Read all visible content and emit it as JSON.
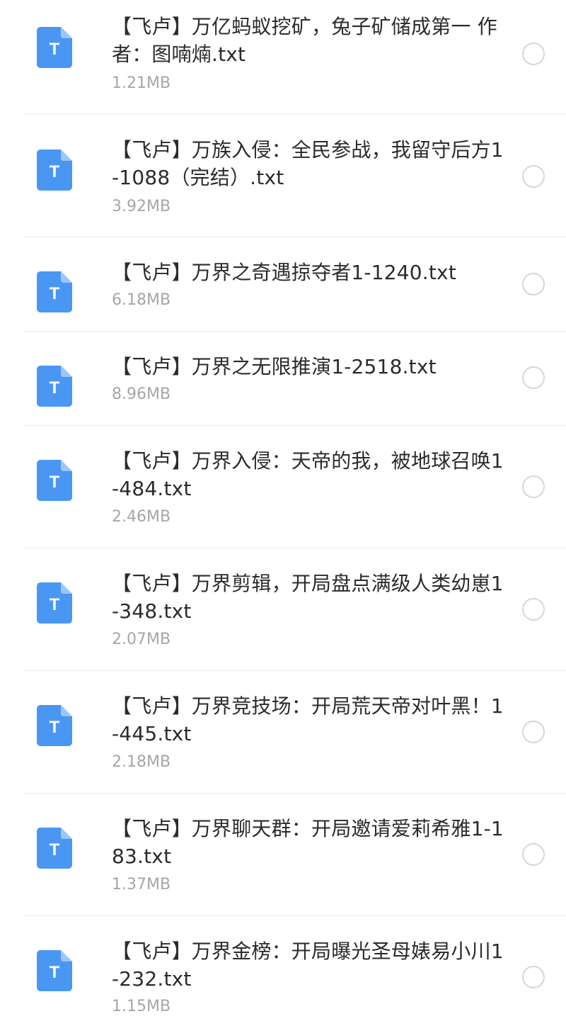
{
  "file_icon": {
    "name": "text-file-icon",
    "glyph": "T",
    "color": "#4a97f3"
  },
  "files": [
    {
      "name": "【飞卢】万亿蚂蚁挖矿，兔子矿储成第一 作者：图喃煵.txt",
      "size": "1.21MB"
    },
    {
      "name": "【飞卢】万族入侵：全民参战，我留守后方1-1088（完结）.txt",
      "size": "3.92MB"
    },
    {
      "name": "【飞卢】万界之奇遇掠夺者1-1240.txt",
      "size": "6.18MB"
    },
    {
      "name": "【飞卢】万界之无限推演1-2518.txt",
      "size": "8.96MB"
    },
    {
      "name": "【飞卢】万界入侵：天帝的我，被地球召唤1-484.txt",
      "size": "2.46MB"
    },
    {
      "name": "【飞卢】万界剪辑，开局盘点满级人类幼崽1-348.txt",
      "size": "2.07MB"
    },
    {
      "name": "【飞卢】万界竞技场：开局荒天帝对叶黑！1-445.txt",
      "size": "2.18MB"
    },
    {
      "name": "【飞卢】万界聊天群：开局邀请爱莉希雅1-183.txt",
      "size": "1.37MB"
    },
    {
      "name": "【飞卢】万界金榜：开局曝光圣母婊易小川1-232.txt",
      "size": "1.15MB"
    }
  ]
}
